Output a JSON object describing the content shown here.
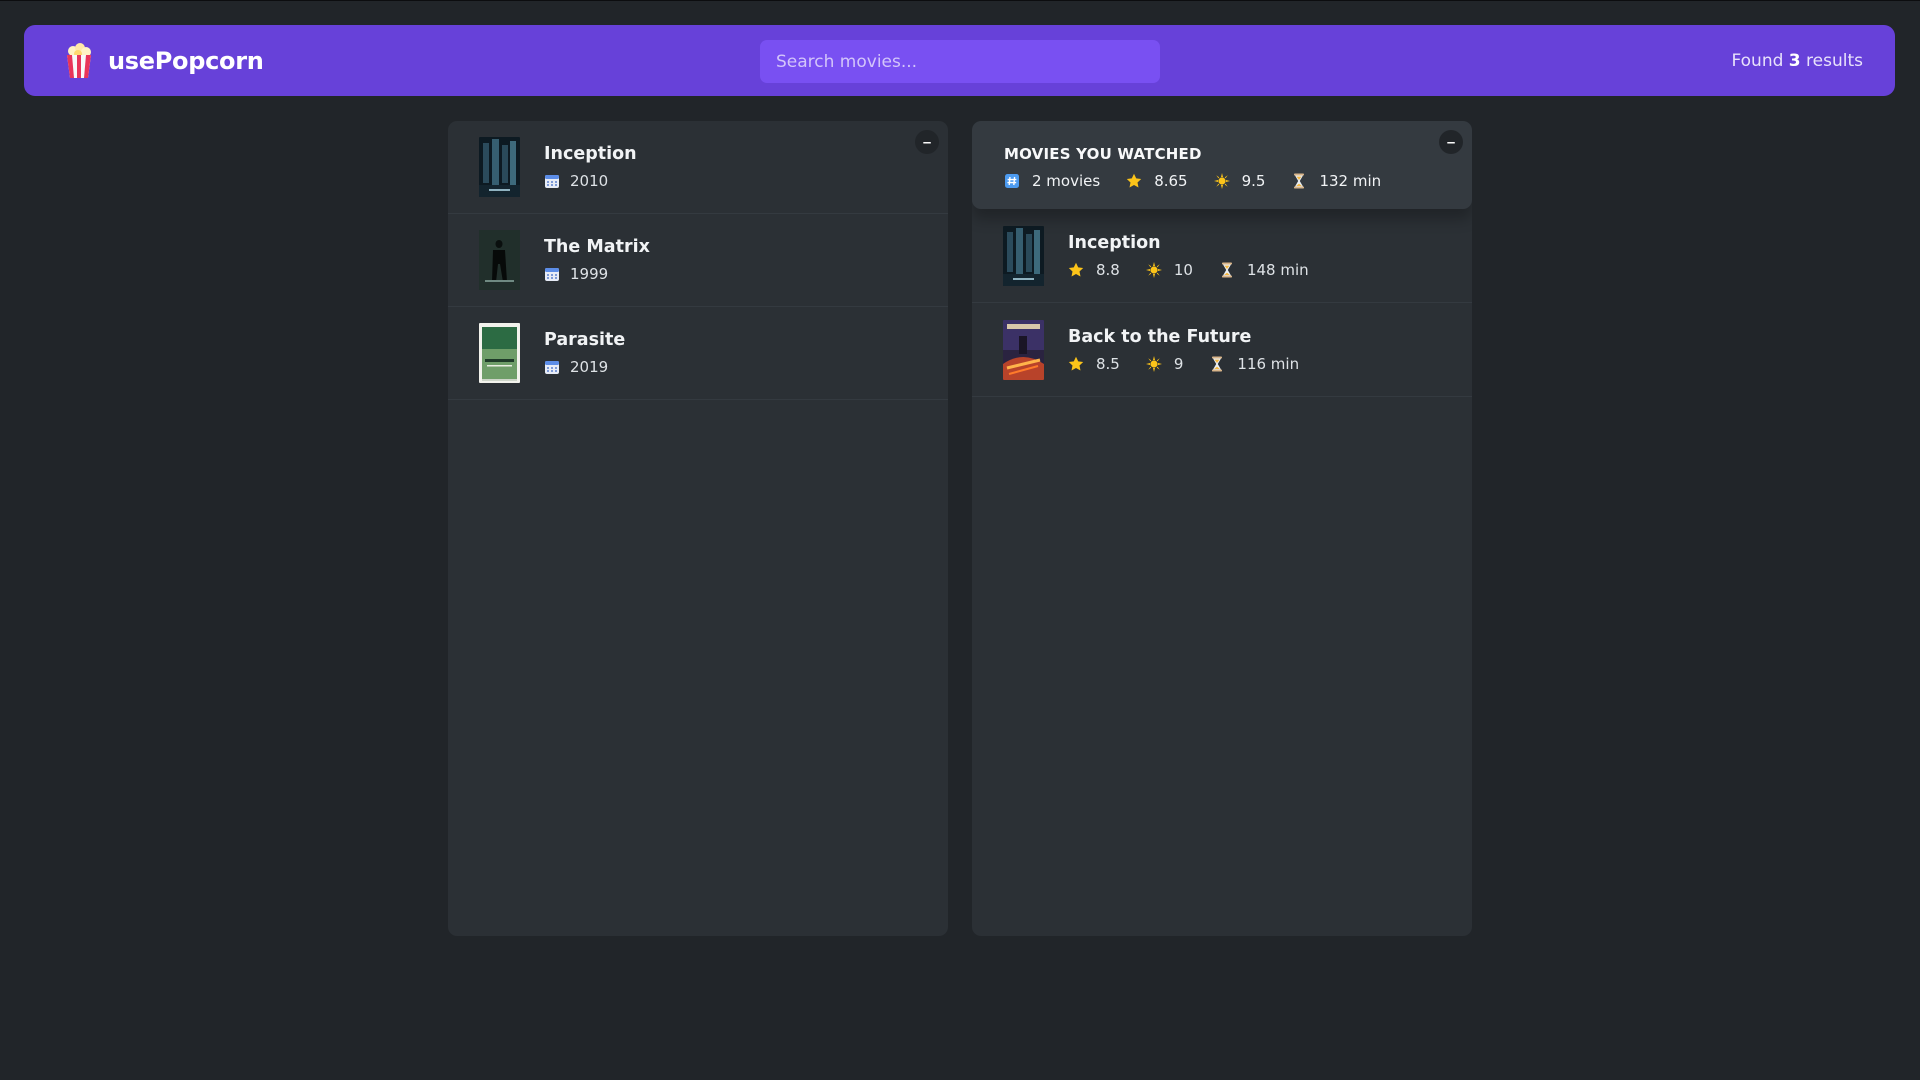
{
  "app": {
    "name": "usePopcorn"
  },
  "search": {
    "placeholder": "Search movies...",
    "value": ""
  },
  "results": {
    "prefix": "Found ",
    "count": "3",
    "suffix": " results"
  },
  "toggle_label": "–",
  "movies": [
    {
      "title": "Inception",
      "year": "2010",
      "poster": "inception-poster"
    },
    {
      "title": "The Matrix",
      "year": "1999",
      "poster": "matrix-poster"
    },
    {
      "title": "Parasite",
      "year": "2019",
      "poster": "parasite-poster"
    }
  ],
  "summary": {
    "title": "Movies you watched",
    "movies_count": "2 movies",
    "imdb_avg": "8.65",
    "user_avg": "9.5",
    "runtime_avg": "132 min"
  },
  "watched": [
    {
      "title": "Inception",
      "imdb_rating": "8.8",
      "user_rating": "10",
      "runtime": "148 min",
      "poster": "inception-poster"
    },
    {
      "title": "Back to the Future",
      "imdb_rating": "8.5",
      "user_rating": "9",
      "runtime": "116 min",
      "poster": "back-to-the-future-poster"
    }
  ],
  "icons": {
    "logo": "popcorn-icon",
    "year": "calendar-icon",
    "count": "hash-icon",
    "imdb": "star-icon",
    "user": "sparkle-icon",
    "runtime": "hourglass-icon"
  },
  "colors": {
    "navbar": "#6741d9",
    "search_bg": "#7950f2",
    "page_bg": "#212529",
    "box_bg": "#2b3035",
    "summary_bg": "#343a40"
  }
}
